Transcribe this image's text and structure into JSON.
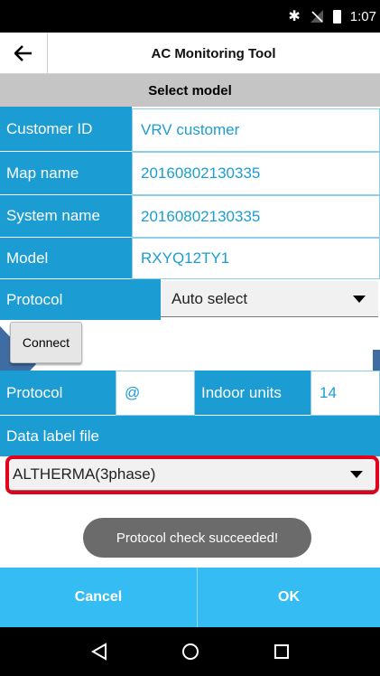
{
  "status_bar": {
    "time": "1:07",
    "icons": [
      "bluetooth-icon",
      "no-signal-icon",
      "battery-icon"
    ]
  },
  "app_bar": {
    "title": "AC Monitoring Tool",
    "back_icon": "back-arrow-icon"
  },
  "section_header": "Select model",
  "fields": {
    "customer_id": {
      "label": "Customer ID",
      "value": "VRV customer"
    },
    "map_name": {
      "label": "Map name",
      "value": "20160802130335"
    },
    "system_name": {
      "label": "System name",
      "value": "20160802130335"
    },
    "model": {
      "label": "Model",
      "value": "RXYQ12TY1"
    },
    "protocol": {
      "label": "Protocol",
      "selected": "Auto select"
    }
  },
  "connect_button": "Connect",
  "result_row": {
    "protocol_label": "Protocol",
    "protocol_value": "@",
    "indoor_units_label": "Indoor units",
    "indoor_units_value": "14"
  },
  "data_label_file": {
    "label": "Data label file",
    "selected": "ALTHERMA(3phase)"
  },
  "toast": "Protocol check succeeded!",
  "footer": {
    "cancel": "Cancel",
    "ok": "OK"
  },
  "colors": {
    "label_bg": "#1b9dd3",
    "footer_bg": "#35bdf3",
    "highlight": "#e3001b",
    "annotation_arrow": "#3e6ca3"
  }
}
